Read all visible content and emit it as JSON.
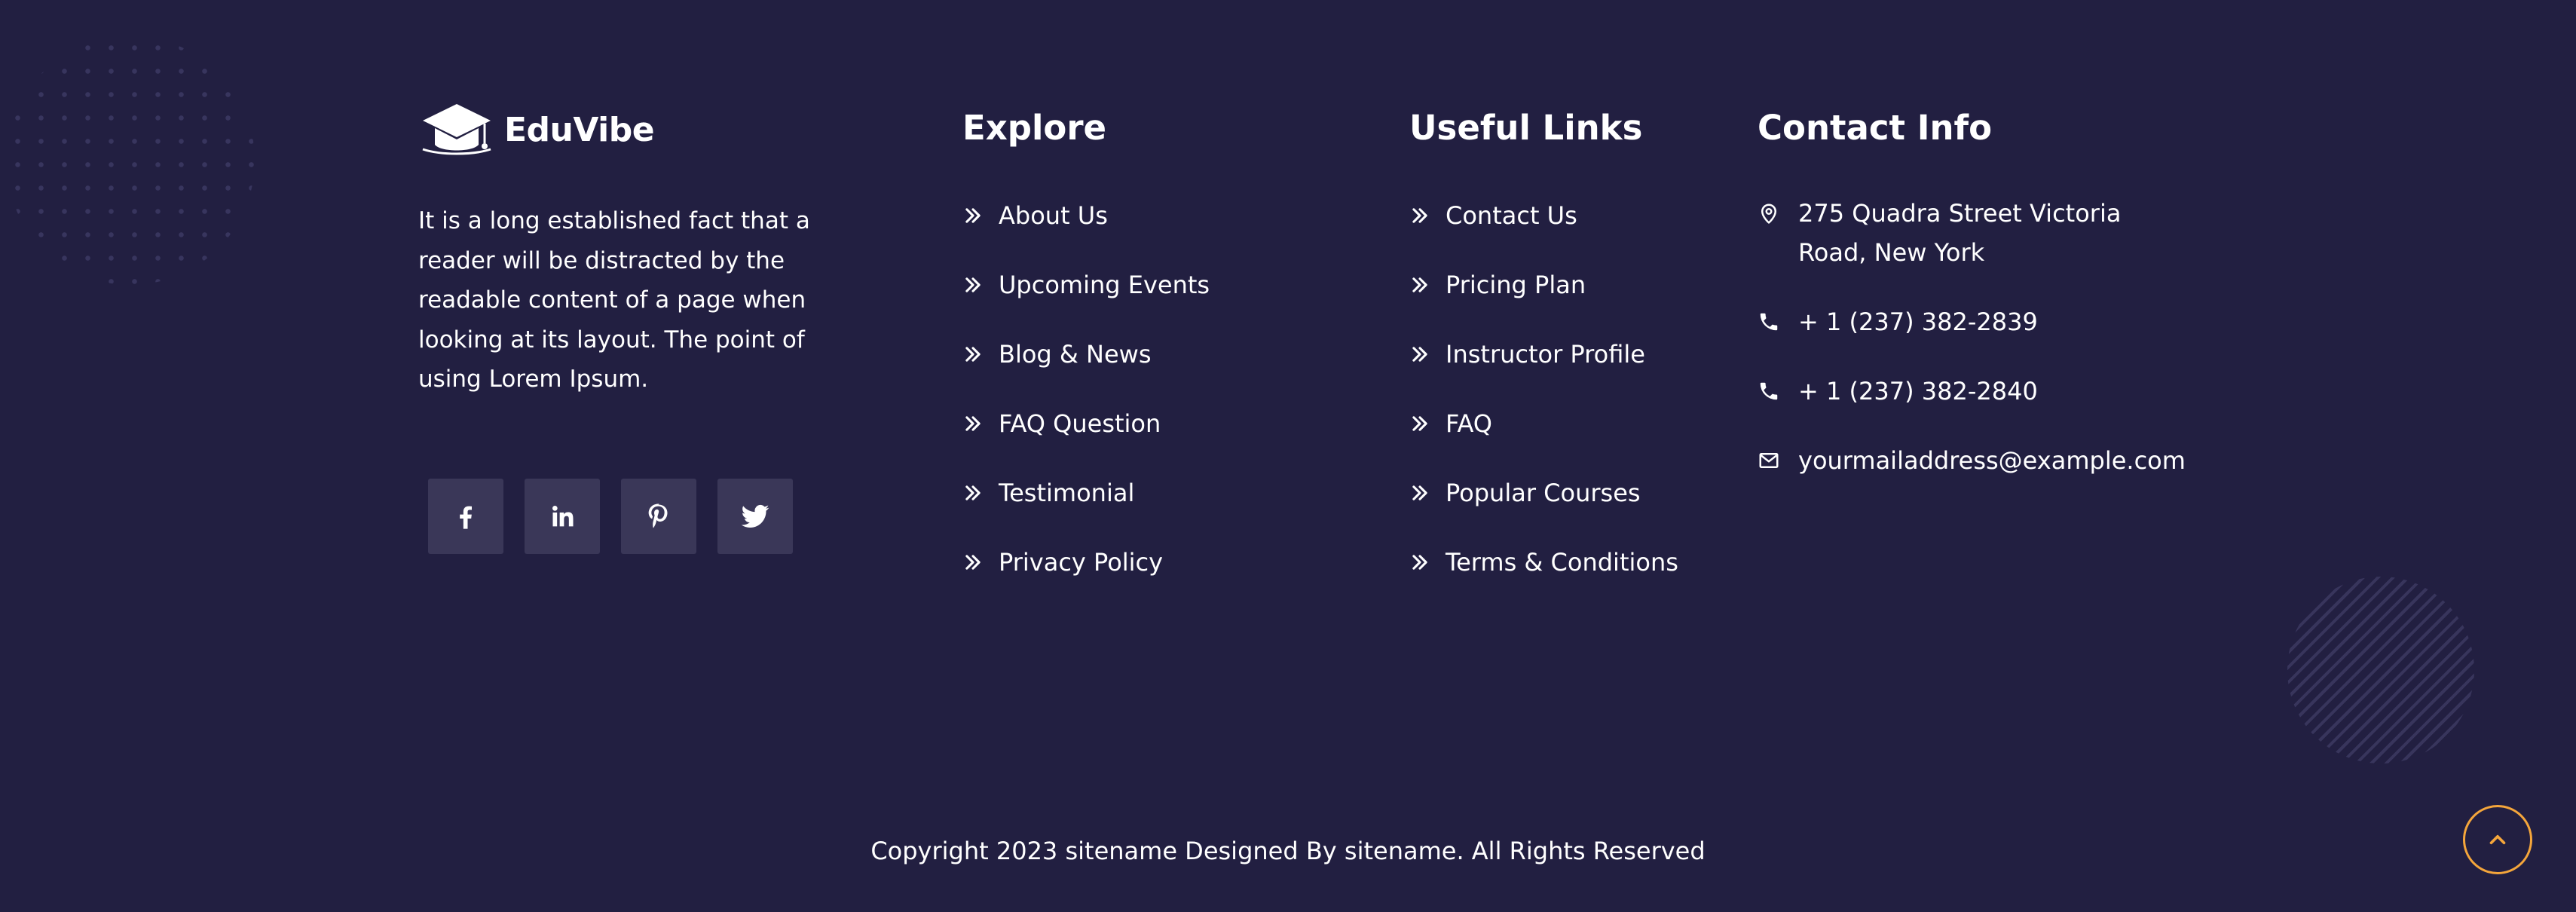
{
  "brand": {
    "name": "EduVibe",
    "description": "It is a long established fact that a reader will be distracted by the readable content of a page when looking at its layout. The point of using Lorem Ipsum."
  },
  "social": [
    {
      "icon": "facebook-icon",
      "label": "f"
    },
    {
      "icon": "linkedin-icon",
      "label": "in"
    },
    {
      "icon": "pinterest-icon",
      "label": "p"
    },
    {
      "icon": "twitter-icon",
      "label": "t"
    }
  ],
  "explore": {
    "title": "Explore",
    "items": [
      "About Us",
      "Upcoming Events",
      "Blog & News",
      "FAQ Question",
      "Testimonial",
      "Privacy Policy"
    ]
  },
  "useful_links": {
    "title": "Useful Links",
    "items": [
      "Contact Us",
      "Pricing Plan",
      "Instructor Profile",
      "FAQ",
      "Popular Courses",
      "Terms & Conditions"
    ]
  },
  "contact": {
    "title": "Contact Info",
    "address": "275 Quadra Street Victoria Road, New York",
    "phone1": "+ 1 (237) 382-2839",
    "phone2": "+ 1 (237) 382-2840",
    "email": "yourmailaddress@example.com"
  },
  "copyright": "Copyright 2023 sitename Designed By sitename. All Rights Reserved",
  "colors": {
    "background": "#221f41",
    "social_bg": "#3a3758",
    "accent": "#f5a63b"
  }
}
